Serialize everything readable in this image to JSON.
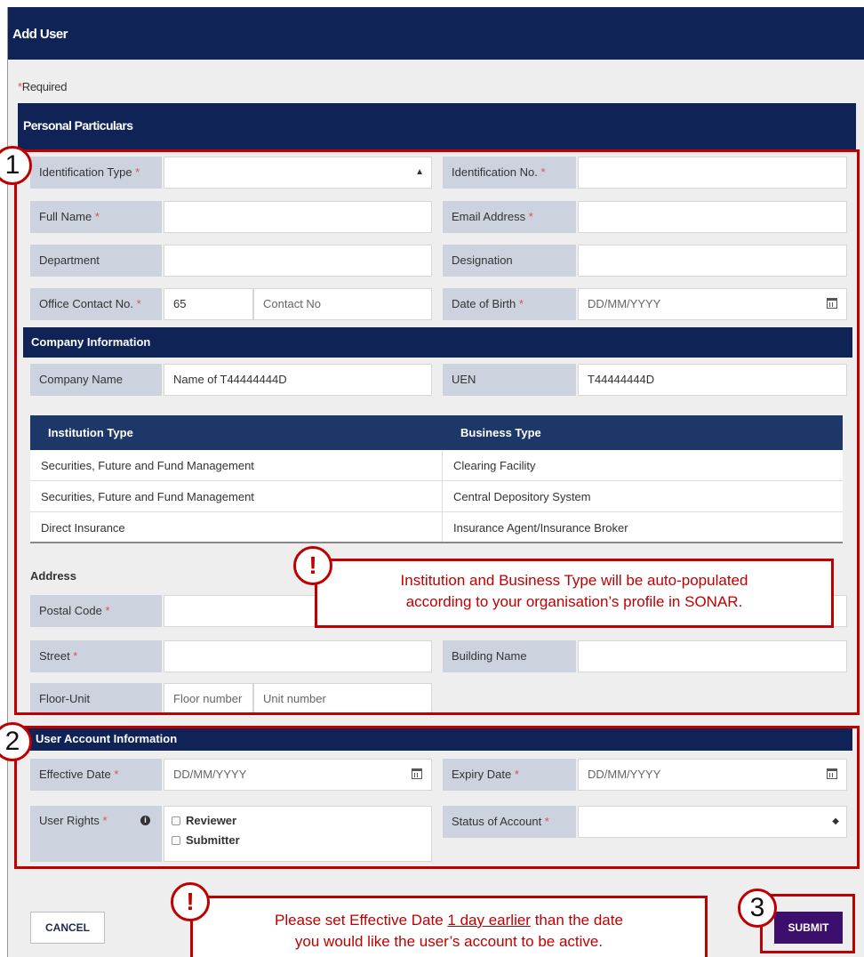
{
  "window": {
    "title": "Add User"
  },
  "required_note": "Required",
  "sections": {
    "personal": "Personal Particulars",
    "company": "Company Information",
    "address": "Address",
    "user_account": "User Account Information"
  },
  "personal": {
    "identification_type": {
      "label": "Identification Type",
      "value": ""
    },
    "identification_no": {
      "label": "Identification No.",
      "value": ""
    },
    "full_name": {
      "label": "Full Name",
      "value": ""
    },
    "email": {
      "label": "Email Address",
      "value": ""
    },
    "department": {
      "label": "Department",
      "value": ""
    },
    "designation": {
      "label": "Designation",
      "value": ""
    },
    "office_contact": {
      "label": "Office Contact No.",
      "country_code": "65",
      "placeholder": "Contact No"
    },
    "dob": {
      "label": "Date of Birth",
      "placeholder": "DD/MM/YYYY"
    }
  },
  "company": {
    "name": {
      "label": "Company Name",
      "value": "Name of T44444444D"
    },
    "uen": {
      "label": "UEN",
      "value": "T44444444D"
    },
    "table": {
      "headers": [
        "Institution Type",
        "Business Type"
      ],
      "rows": [
        [
          "Securities, Future and Fund Management",
          "Clearing Facility"
        ],
        [
          "Securities, Future and Fund Management",
          "Central Depository System"
        ],
        [
          "Direct Insurance",
          "Insurance Agent/Insurance Broker"
        ]
      ]
    }
  },
  "address": {
    "postal_code": {
      "label": "Postal Code",
      "value": ""
    },
    "street": {
      "label": "Street",
      "value": ""
    },
    "building": {
      "label": "Building Name",
      "value": ""
    },
    "floor_unit": {
      "label": "Floor-Unit",
      "floor_placeholder": "Floor number",
      "unit_placeholder": "Unit number"
    }
  },
  "user_account": {
    "effective_date": {
      "label": "Effective Date",
      "placeholder": "DD/MM/YYYY"
    },
    "expiry_date": {
      "label": "Expiry Date",
      "placeholder": "DD/MM/YYYY"
    },
    "user_rights": {
      "label": "User Rights",
      "options": [
        "Reviewer",
        "Submitter"
      ]
    },
    "status": {
      "label": "Status of Account",
      "value": ""
    }
  },
  "buttons": {
    "cancel": "CANCEL",
    "submit": "SUBMIT"
  },
  "annotations": {
    "markers": [
      "1",
      "2",
      "3"
    ],
    "exclaim": "!",
    "callout_1": [
      "Institution and Business Type will be auto-populated",
      "according to your organisation’s profile in SONAR."
    ],
    "callout_2": {
      "pre": "Please set Effective Date ",
      "underlined": "1 day earlier",
      "post": " than the date",
      "line2": "you would like the user’s account to be active."
    }
  },
  "colors": {
    "header_navy": "#0f2357",
    "label_bg": "#ccd3de",
    "submit_purple": "#3b0f6b",
    "annotation_red": "#c00000",
    "required_red": "#e05050"
  }
}
